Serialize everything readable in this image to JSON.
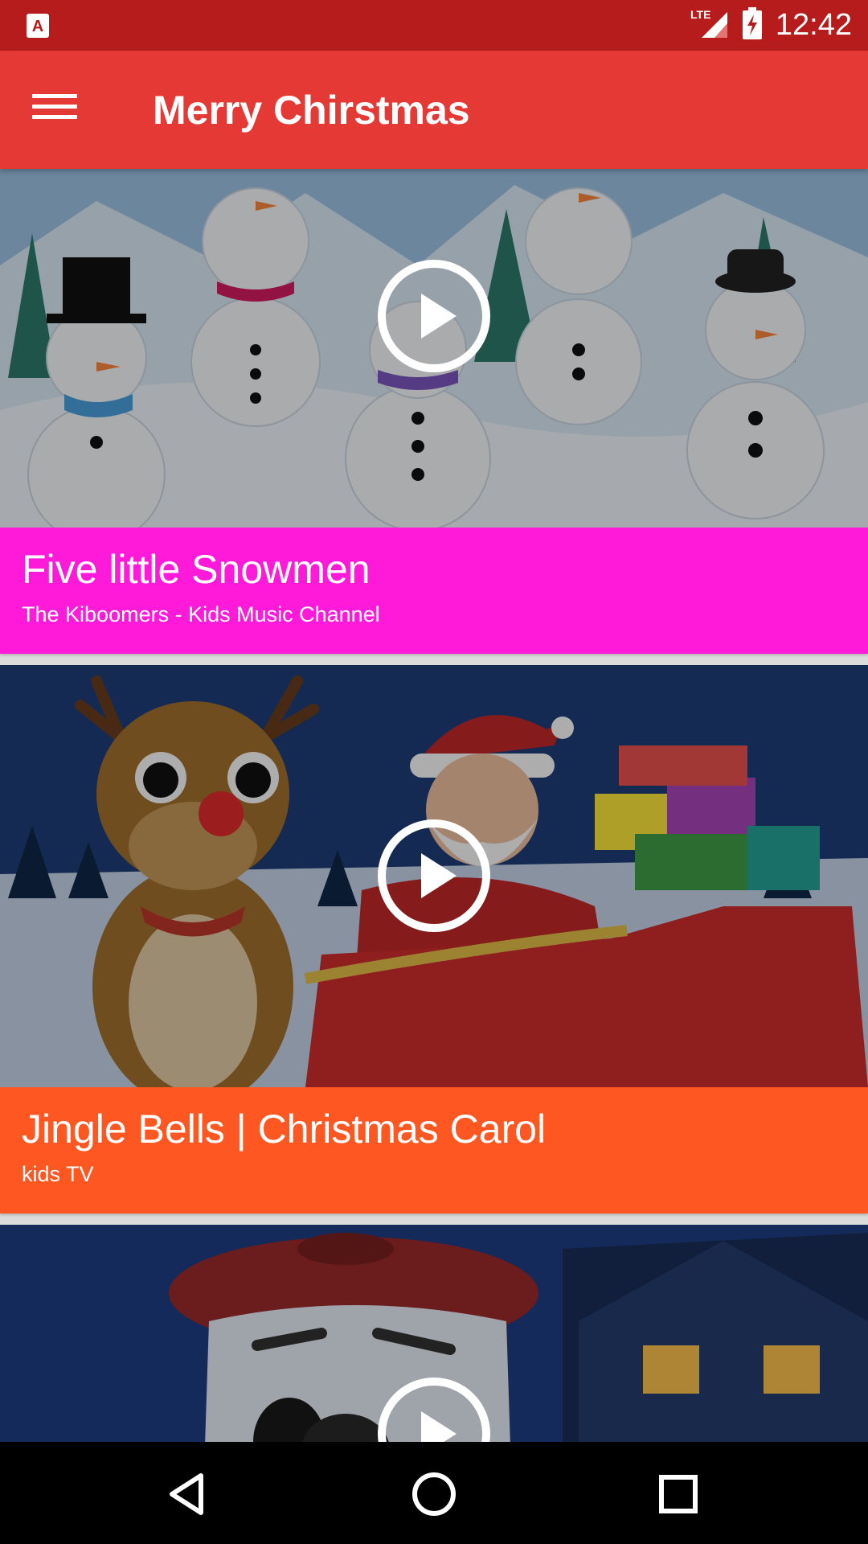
{
  "status_bar": {
    "time": "12:42",
    "network": "LTE",
    "icons": [
      "app-notification-icon",
      "lte-signal-icon",
      "battery-charging-icon"
    ]
  },
  "app_bar": {
    "title": "Merry Chirstmas",
    "menu_icon": "hamburger-menu-icon"
  },
  "videos": [
    {
      "title": "Five little Snowmen",
      "channel": "The Kiboomers - Kids Music Channel",
      "caption_color": "#ff1ad9",
      "thumbnail": "snowmen-thumbnail",
      "play_icon": "play-circle-icon"
    },
    {
      "title": "Jingle Bells | Christmas Carol",
      "channel": "kids TV",
      "caption_color": "#ff5722",
      "thumbnail": "santa-reindeer-thumbnail",
      "play_icon": "play-circle-icon"
    },
    {
      "title": "",
      "channel": "",
      "thumbnail": "snowman-night-thumbnail",
      "play_icon": "play-circle-icon"
    }
  ],
  "nav_bar": {
    "back": "back-triangle-icon",
    "home": "home-circle-icon",
    "recents": "recents-square-icon"
  },
  "colors": {
    "status_bar": "#b71c1c",
    "app_bar": "#e53935"
  }
}
